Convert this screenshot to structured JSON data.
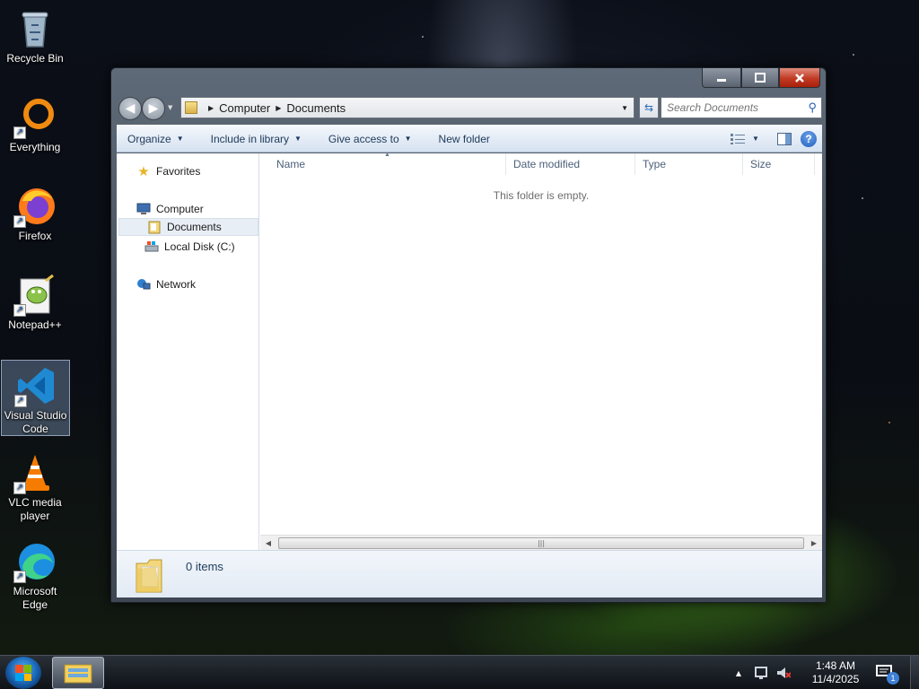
{
  "desktop": {
    "icons": [
      {
        "label": "Recycle Bin",
        "icon": "recycle-bin-icon"
      },
      {
        "label": "Everything",
        "icon": "everything-icon"
      },
      {
        "label": "Firefox",
        "icon": "firefox-icon"
      },
      {
        "label": "Notepad++",
        "icon": "notepad-plus-plus-icon"
      },
      {
        "label": "Visual Studio Code",
        "icon": "vscode-icon"
      },
      {
        "label": "VLC media player",
        "icon": "vlc-icon"
      },
      {
        "label": "Microsoft Edge",
        "icon": "edge-icon"
      }
    ]
  },
  "window": {
    "address": {
      "crumbs": [
        "Computer",
        "Documents"
      ]
    },
    "search": {
      "placeholder": "Search Documents"
    },
    "toolbar": {
      "organize": "Organize",
      "include_in_library": "Include in library",
      "give_access_to": "Give access to",
      "new_folder": "New folder"
    },
    "nav": {
      "favorites": "Favorites",
      "computer": "Computer",
      "documents": "Documents",
      "local_disk": "Local Disk (C:)",
      "network": "Network"
    },
    "columns": {
      "name": "Name",
      "date_modified": "Date modified",
      "type": "Type",
      "size": "Size"
    },
    "empty_message": "This folder is empty.",
    "details": {
      "item_count": "0 items"
    }
  },
  "taskbar": {
    "clock": {
      "time": "1:48 AM",
      "date": "11/4/2025"
    },
    "notification_count": "1"
  },
  "colors": {
    "accent": "#1f5fbf",
    "toolbar_text": "#1e395b",
    "close_button": "#c13a23"
  }
}
